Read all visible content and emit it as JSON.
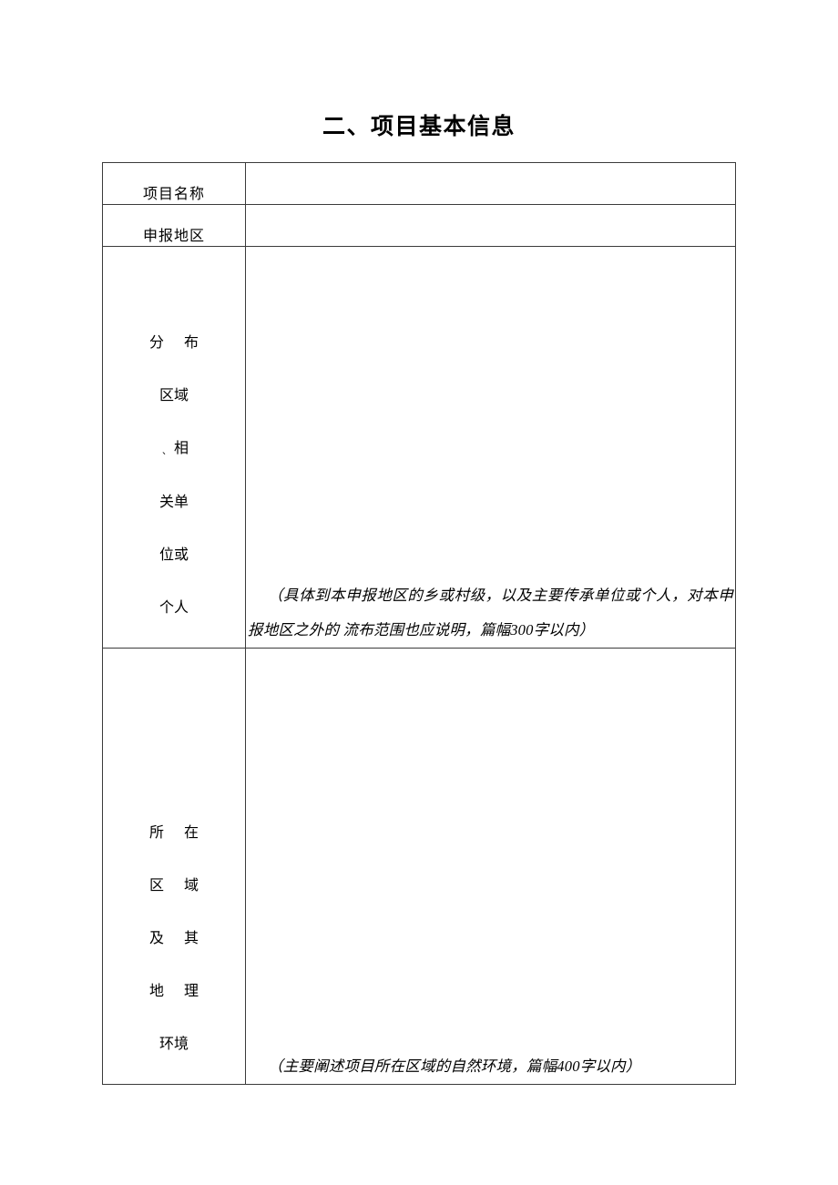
{
  "document": {
    "title": "二、项目基本信息"
  },
  "table": {
    "rows": {
      "project_name": {
        "label": "项目名称",
        "value": ""
      },
      "application_region": {
        "label": "申报地区",
        "value": ""
      },
      "distribution": {
        "label_lines": [
          "分 布",
          "区域",
          "相",
          "关单",
          "位或",
          "个人"
        ],
        "label_mark": "、",
        "label_full": "分布区域、相关单位或个人",
        "hint_line1": "（具体到本申报地区的乡或村级，以及主要传承单位或个人，对本申报地区之外的",
        "hint_line2": "流布范围也应说明，篇幅300字以内）",
        "hint_full": "（具体到本申报地区的乡或村级，以及主要传承单位或个人，对本申报地区之外的流布范围也应说明，篇幅300字以内）",
        "value": ""
      },
      "geography": {
        "label_lines": [
          "所 在",
          "区 域",
          "及 其",
          "地 理",
          "环境"
        ],
        "label_full": "所在区域及其地理环境",
        "hint_line1": "（主要阐述项目所在区域的自然环境，篇幅400字以内）",
        "hint_full": "（主要阐述项目所在区域的自然环境，篇幅400字以内）",
        "value": ""
      }
    }
  }
}
